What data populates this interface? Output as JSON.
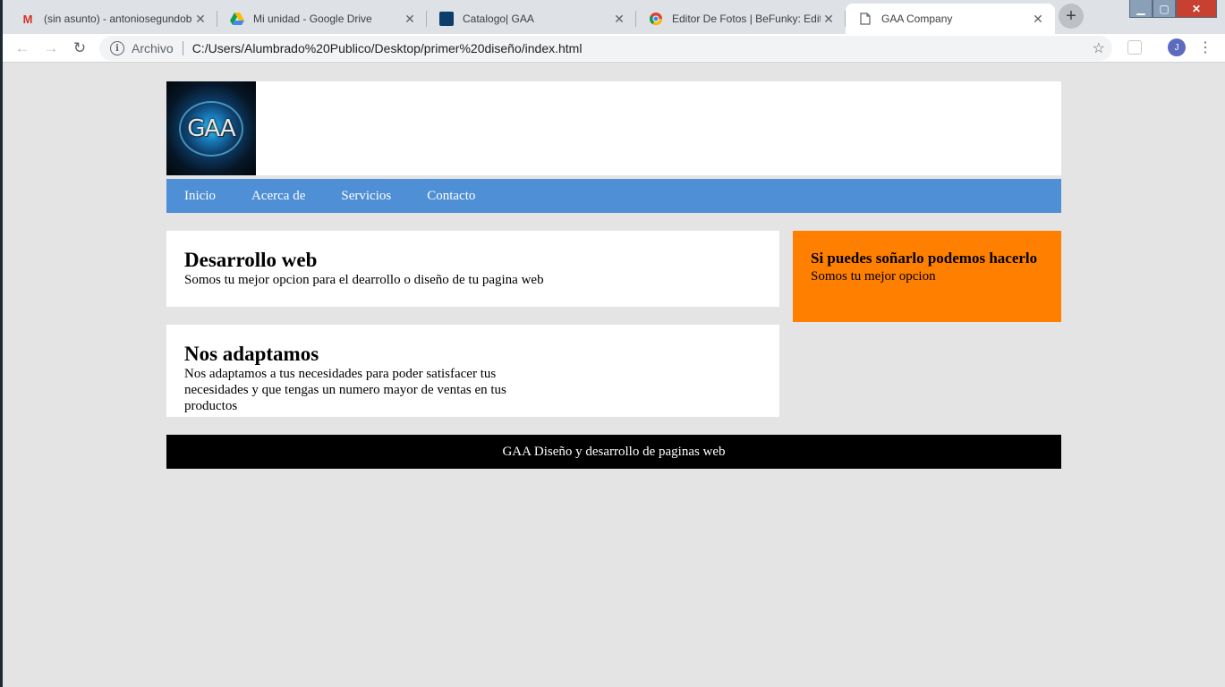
{
  "browser": {
    "tabs": [
      {
        "title": "(sin asunto) - antoniosegundob",
        "icon": "gmail-icon",
        "active": false
      },
      {
        "title": "Mi unidad - Google Drive",
        "icon": "google-drive-icon",
        "active": false
      },
      {
        "title": "Catalogo| GAA",
        "icon": "gaa-logo-icon",
        "active": false
      },
      {
        "title": "Editor De Fotos | BeFunky: Edita",
        "icon": "chrome-icon",
        "active": false
      },
      {
        "title": "GAA Company",
        "icon": "page-icon",
        "active": true
      }
    ],
    "address": {
      "scheme": "Archivo",
      "url": "C:/Users/Alumbrado%20Publico/Desktop/primer%20diseño/index.html"
    },
    "profile_initial": "J"
  },
  "site": {
    "logo_text": "GAA",
    "nav": [
      "Inicio",
      "Acerca de",
      "Servicios",
      "Contacto"
    ],
    "card1": {
      "title": "Desarrollo web",
      "text": "Somos tu mejor opcion para el dearrollo o diseño de tu pagina web"
    },
    "card2": {
      "title": "Nos adaptamos",
      "text": "Nos adaptamos a tus necesidades para poder satisfacer tus necesidades y que tengas un numero mayor de ventas en tus productos"
    },
    "aside": {
      "title": "Si puedes soñarlo podemos hacerlo",
      "text": "Somos tu mejor opcion"
    },
    "footer": "GAA Diseño y desarrollo de paginas web"
  },
  "colors": {
    "nav_bg": "#4f8fd6",
    "aside_bg": "#ff7f00",
    "footer_bg": "#000000",
    "page_bg": "#e4e4e4"
  }
}
